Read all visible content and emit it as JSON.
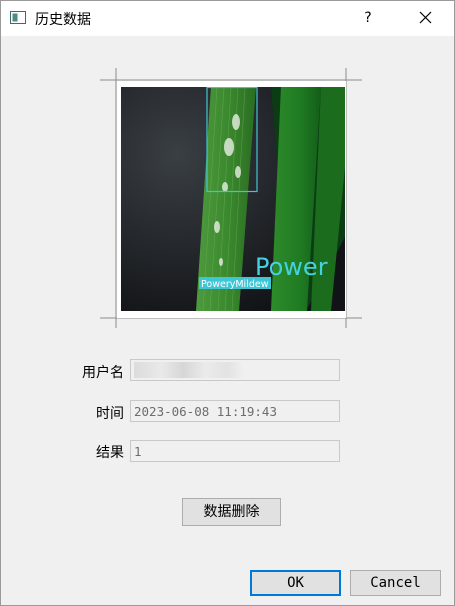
{
  "window": {
    "title": "历史数据",
    "help_label": "?",
    "app_icon": "window-app-icon",
    "close_icon": "close-icon"
  },
  "image": {
    "detection_label": "PoweryMildew",
    "overlay_text": "Power",
    "box_color": "#3fc6d6"
  },
  "form": {
    "username_label": "用户名",
    "username_value": "",
    "time_label": "时间",
    "time_value": "2023-06-08 11:19:43",
    "result_label": "结果",
    "result_value": "1"
  },
  "buttons": {
    "delete_label": "数据删除",
    "ok_label": "OK",
    "cancel_label": "Cancel"
  },
  "colors": {
    "accent": "#0078d7",
    "background": "#f0f0f0"
  }
}
